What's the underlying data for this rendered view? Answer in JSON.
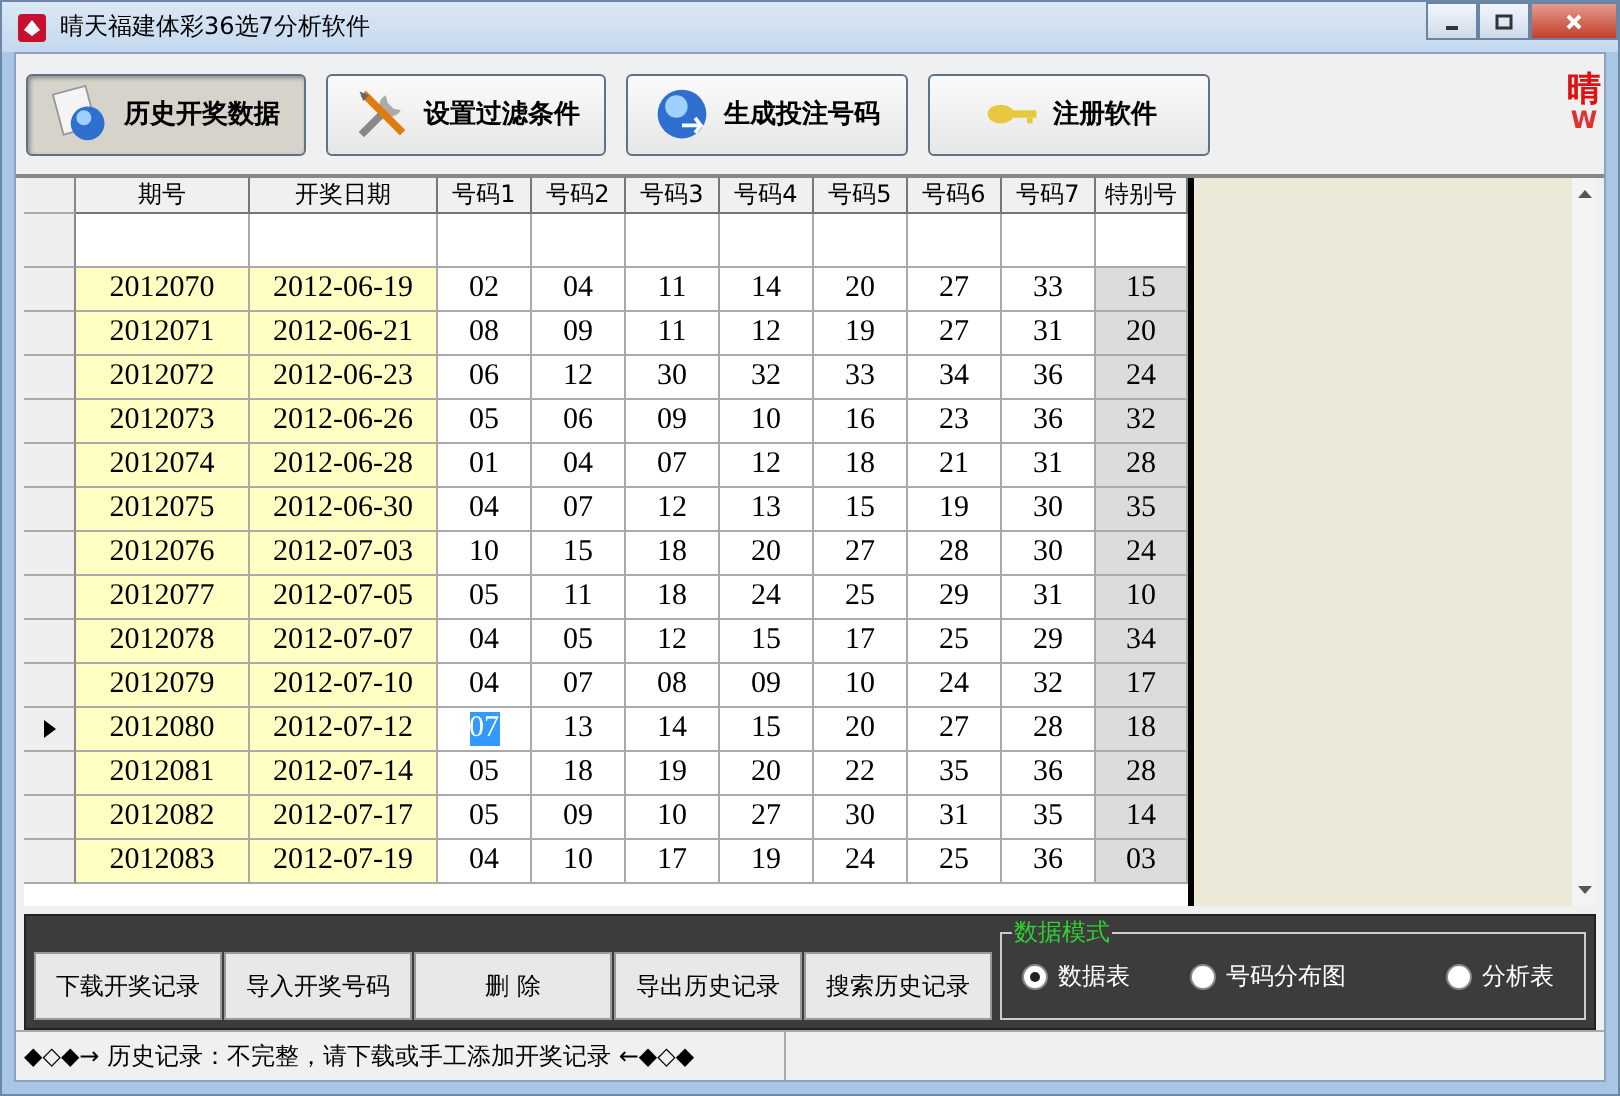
{
  "window": {
    "title": "晴天福建体彩36选7分析软件"
  },
  "toolbar": [
    {
      "label": "历史开奖数据",
      "selected": true
    },
    {
      "label": "设置过滤条件",
      "selected": false
    },
    {
      "label": "生成投注号码",
      "selected": false
    },
    {
      "label": "注册软件",
      "selected": false
    }
  ],
  "logo": {
    "text": "晴",
    "sub": "W"
  },
  "table": {
    "columns": [
      "期号",
      "开奖日期",
      "号码1",
      "号码2",
      "号码3",
      "号码4",
      "号码5",
      "号码6",
      "号码7",
      "特别号"
    ],
    "rows": [
      {
        "cells": [
          "2012070",
          "2012-06-19",
          "02",
          "04",
          "11",
          "14",
          "20",
          "27",
          "33",
          "15"
        ],
        "current": false
      },
      {
        "cells": [
          "2012071",
          "2012-06-21",
          "08",
          "09",
          "11",
          "12",
          "19",
          "27",
          "31",
          "20"
        ],
        "current": false
      },
      {
        "cells": [
          "2012072",
          "2012-06-23",
          "06",
          "12",
          "30",
          "32",
          "33",
          "34",
          "36",
          "24"
        ],
        "current": false
      },
      {
        "cells": [
          "2012073",
          "2012-06-26",
          "05",
          "06",
          "09",
          "10",
          "16",
          "23",
          "36",
          "32"
        ],
        "current": false
      },
      {
        "cells": [
          "2012074",
          "2012-06-28",
          "01",
          "04",
          "07",
          "12",
          "18",
          "21",
          "31",
          "28"
        ],
        "current": false
      },
      {
        "cells": [
          "2012075",
          "2012-06-30",
          "04",
          "07",
          "12",
          "13",
          "15",
          "19",
          "30",
          "35"
        ],
        "current": false
      },
      {
        "cells": [
          "2012076",
          "2012-07-03",
          "10",
          "15",
          "18",
          "20",
          "27",
          "28",
          "30",
          "24"
        ],
        "current": false
      },
      {
        "cells": [
          "2012077",
          "2012-07-05",
          "05",
          "11",
          "18",
          "24",
          "25",
          "29",
          "31",
          "10"
        ],
        "current": false
      },
      {
        "cells": [
          "2012078",
          "2012-07-07",
          "04",
          "05",
          "12",
          "15",
          "17",
          "25",
          "29",
          "34"
        ],
        "current": false
      },
      {
        "cells": [
          "2012079",
          "2012-07-10",
          "04",
          "07",
          "08",
          "09",
          "10",
          "24",
          "32",
          "17"
        ],
        "current": false
      },
      {
        "cells": [
          "2012080",
          "2012-07-12",
          "07",
          "13",
          "14",
          "15",
          "20",
          "27",
          "28",
          "18"
        ],
        "current": true,
        "highlighted": [
          false,
          false,
          true,
          false,
          false,
          false,
          false,
          false,
          false,
          false
        ]
      },
      {
        "cells": [
          "2012081",
          "2012-07-14",
          "05",
          "18",
          "19",
          "20",
          "22",
          "35",
          "36",
          "28"
        ],
        "current": false
      },
      {
        "cells": [
          "2012082",
          "2012-07-17",
          "05",
          "09",
          "10",
          "27",
          "30",
          "31",
          "35",
          "14"
        ],
        "current": false
      },
      {
        "cells": [
          "2012083",
          "2012-07-19",
          "04",
          "10",
          "17",
          "19",
          "24",
          "25",
          "36",
          "03"
        ],
        "current": false
      }
    ]
  },
  "actions": [
    "下载开奖记录",
    "导入开奖号码",
    "删 除",
    "导出历史记录",
    "搜索历史记录"
  ],
  "mode": {
    "title": "数据模式",
    "options": [
      {
        "label": "数据表",
        "selected": true
      },
      {
        "label": "号码分布图",
        "selected": false
      },
      {
        "label": "分析表",
        "selected": false
      }
    ]
  },
  "status_bar": {
    "message": "◆◇◆→ 历史记录：不完整，请下载或手工添加开奖记录 ←◆◇◆"
  }
}
